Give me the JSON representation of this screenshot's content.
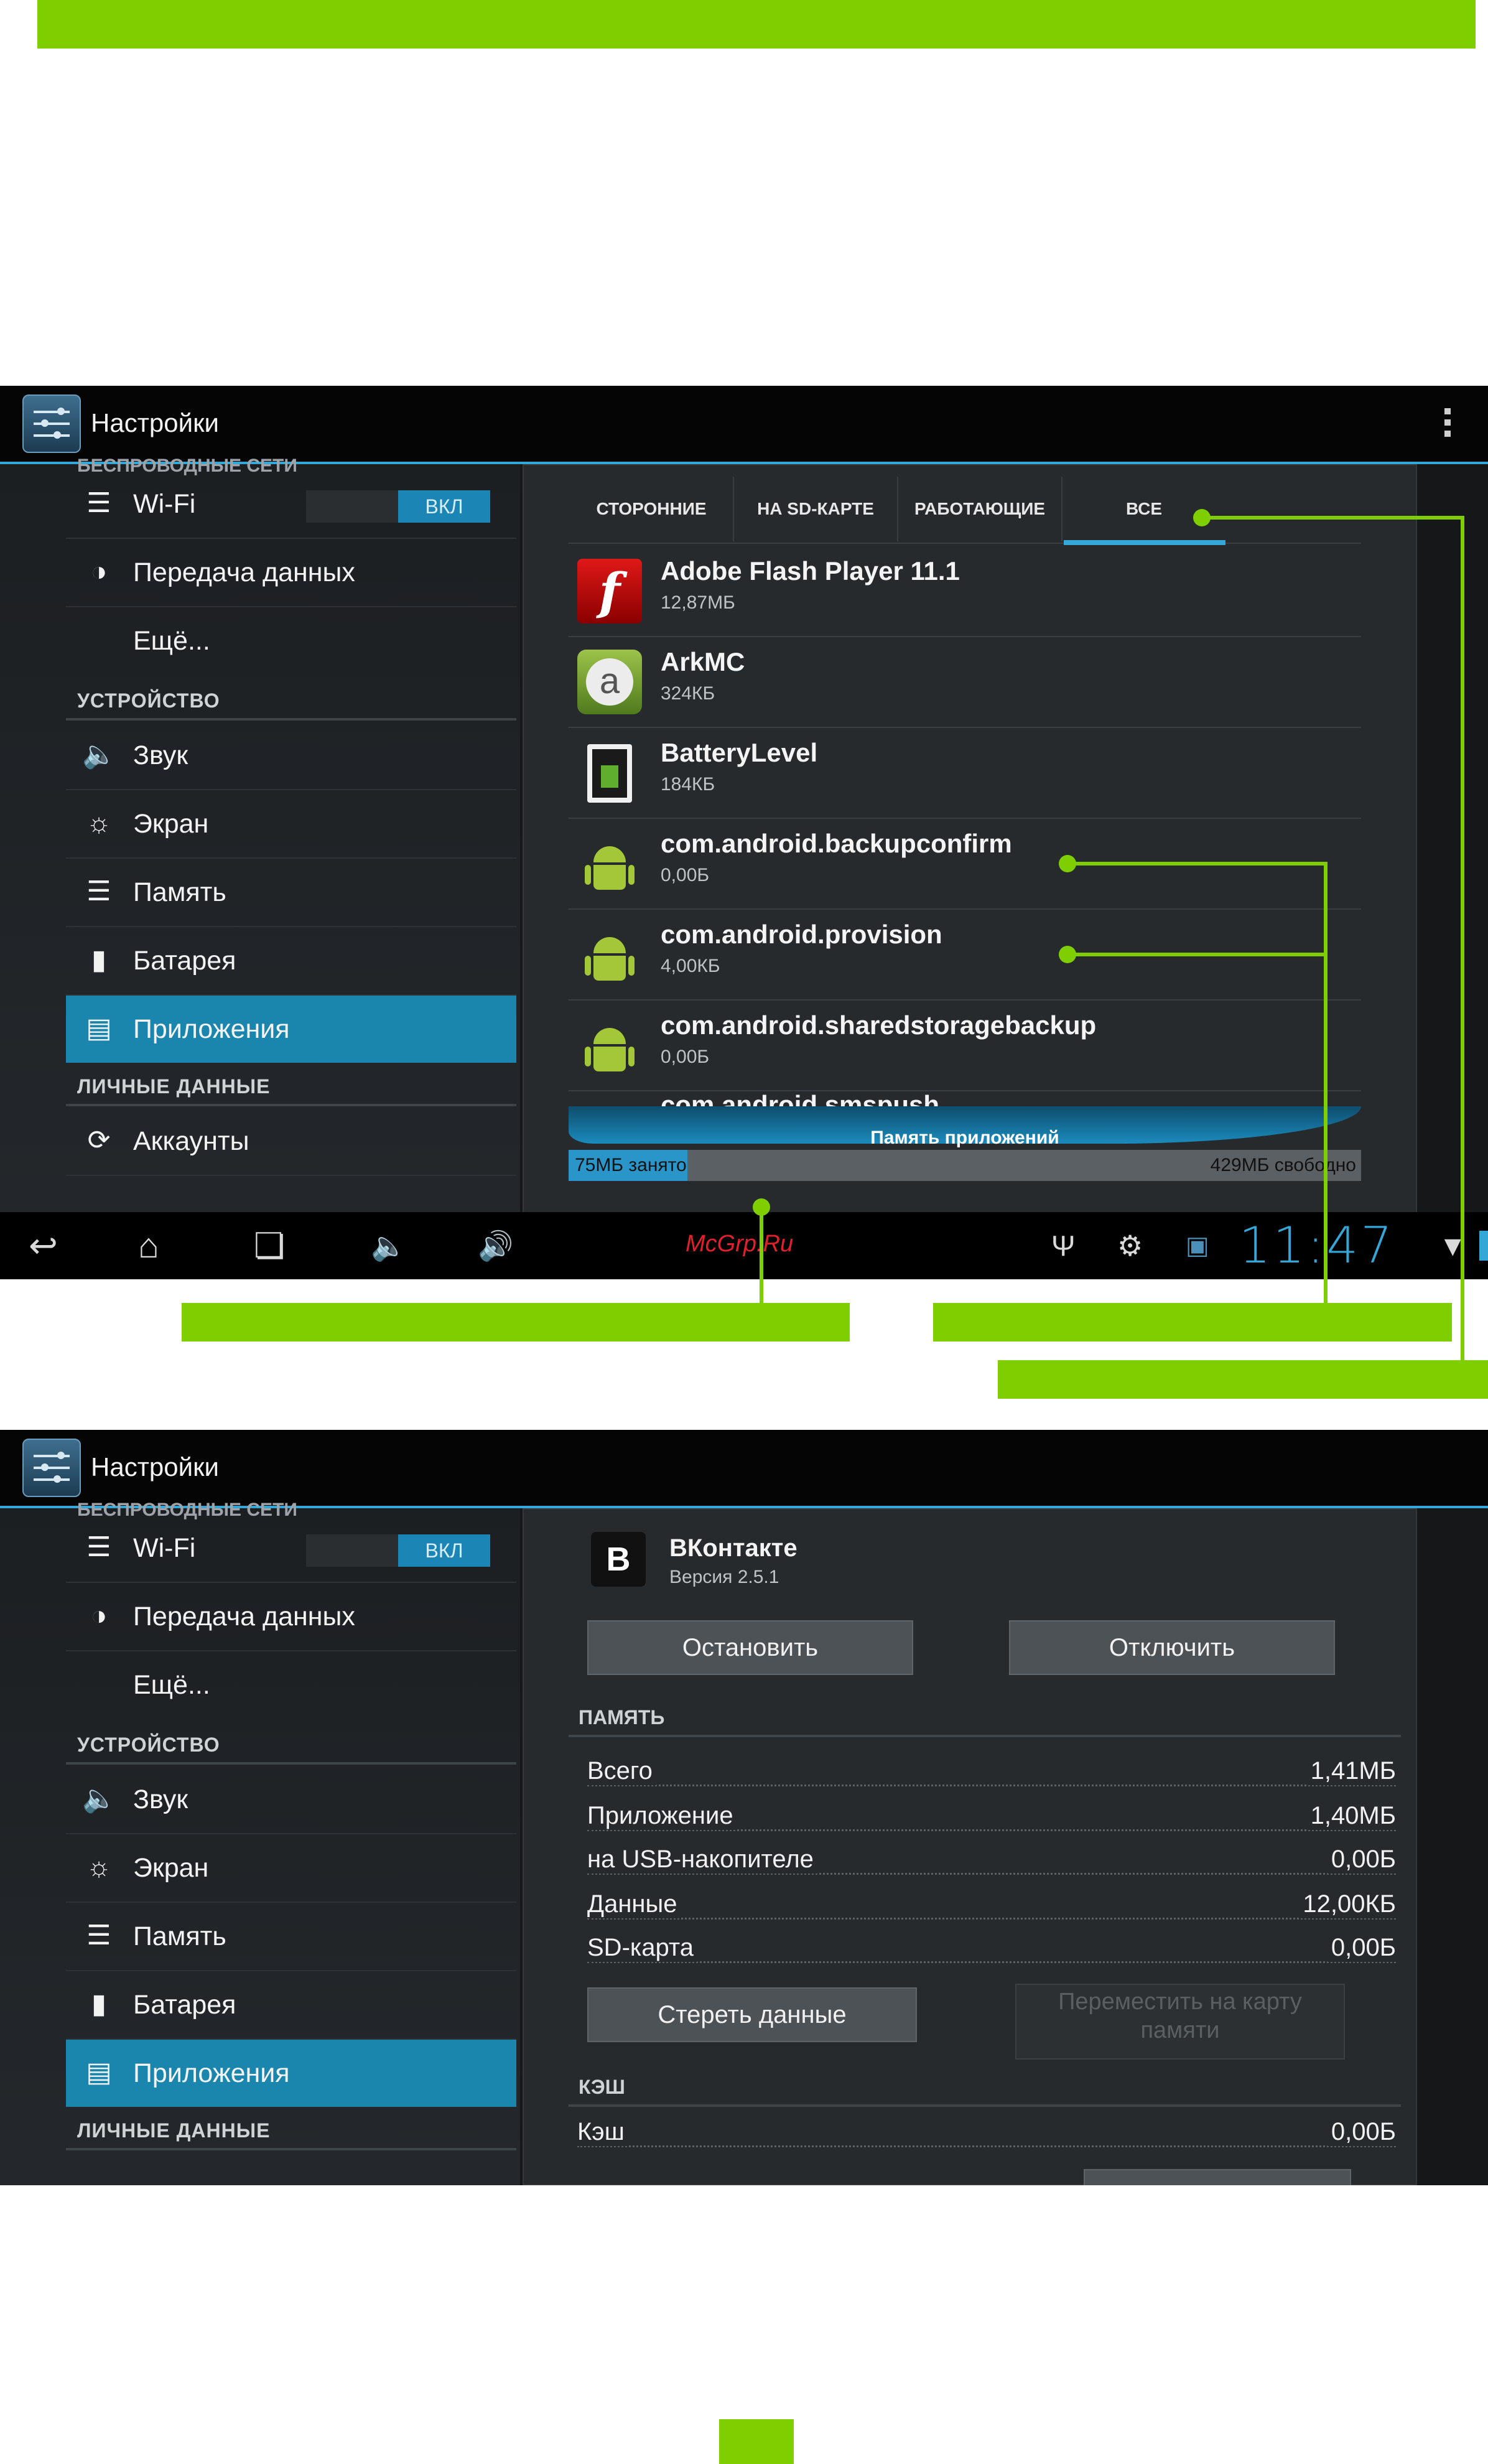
{
  "common": {
    "app_title": "Настройки",
    "wifi_label": "Wi-Fi",
    "toggle_on": "ВКЛ",
    "data_usage": "Передача данных",
    "more": "Ещё...",
    "section_device": "УСТРОЙСТВО",
    "sound": "Звук",
    "display": "Экран",
    "storage": "Память",
    "battery": "Батарея",
    "apps": "Приложения",
    "section_personal": "ЛИЧНЫЕ ДАННЫЕ",
    "accounts": "Аккаунты",
    "clipped_section": "БЕСПРОВОДНЫЕ СЕТИ"
  },
  "screen1": {
    "tabs": [
      "СТОРОННИЕ",
      "НА SD-КАРТЕ",
      "РАБОТАЮЩИЕ",
      "ВСЕ"
    ],
    "apps": [
      {
        "name": "Adobe Flash Player 11.1",
        "size": "12,87МБ"
      },
      {
        "name": "ArkMC",
        "size": "324КБ"
      },
      {
        "name": "BatteryLevel",
        "size": "184КБ"
      },
      {
        "name": "com.android.backupconfirm",
        "size": "0,00Б"
      },
      {
        "name": "com.android.provision",
        "size": "4,00КБ"
      },
      {
        "name": "com.android.sharedstoragebackup",
        "size": "0,00Б"
      },
      {
        "name": "com.android.smspush",
        "size": ""
      }
    ],
    "storage_label": "Память приложений",
    "used": "75МБ занято",
    "free": "429МБ свободно",
    "used_fraction": 0.15,
    "watermark": "McGrp.Ru",
    "clock": "11:47"
  },
  "screen2": {
    "app_name": "ВКонтакте",
    "version": "Версия 2.5.1",
    "icon_letter": "B",
    "stop_button": "Остановить",
    "disable_button": "Отключить",
    "memory_section": "ПАМЯТЬ",
    "rows": [
      {
        "k": "Всего",
        "v": "1,41МБ"
      },
      {
        "k": "Приложение",
        "v": "1,40МБ"
      },
      {
        "k": "на USB-накопителе",
        "v": "0,00Б"
      },
      {
        "k": "Данные",
        "v": "12,00КБ"
      },
      {
        "k": "SD-карта",
        "v": "0,00Б"
      }
    ],
    "clear_data_button": "Стереть данные",
    "move_button": "Переместить на карту памяти",
    "cache_section": "КЭШ",
    "cache_label": "Кэш",
    "cache_value": "0,00Б"
  },
  "colors": {
    "accent_green": "#7fce00",
    "holo_blue": "#35a7d6"
  }
}
